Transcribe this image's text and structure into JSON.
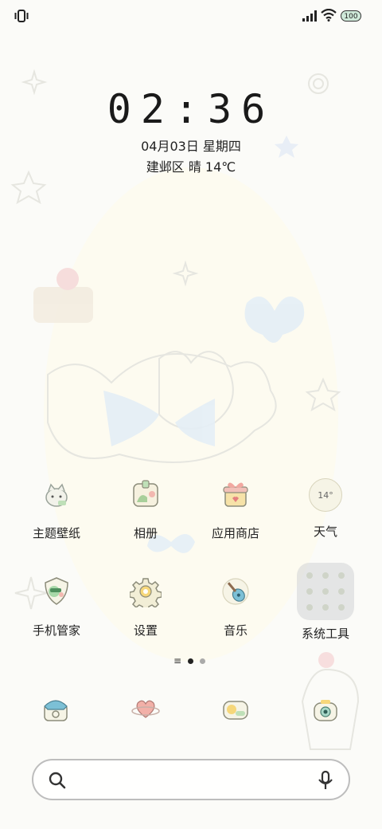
{
  "status_bar": {
    "battery": "100"
  },
  "lockclock": {
    "time": "02:36",
    "date": "04月03日 星期四",
    "weather": "建邺区 晴 14℃"
  },
  "apps": {
    "row1": [
      {
        "label": "主题壁纸",
        "icon": "cat-theme-icon"
      },
      {
        "label": "相册",
        "icon": "gallery-icon"
      },
      {
        "label": "应用商店",
        "icon": "gift-store-icon"
      },
      {
        "label": "天气",
        "icon": "weather-icon",
        "icon_text": "14°"
      }
    ],
    "row2": [
      {
        "label": "手机管家",
        "icon": "shield-manager-icon"
      },
      {
        "label": "设置",
        "icon": "gear-icon"
      },
      {
        "label": "音乐",
        "icon": "guitar-icon"
      },
      {
        "label": "系统工具",
        "icon": "folder-icon"
      }
    ]
  },
  "dock": [
    "phone-icon",
    "planet-heart-icon",
    "messages-icon",
    "camera-icon"
  ],
  "search": {
    "placeholder": ""
  }
}
